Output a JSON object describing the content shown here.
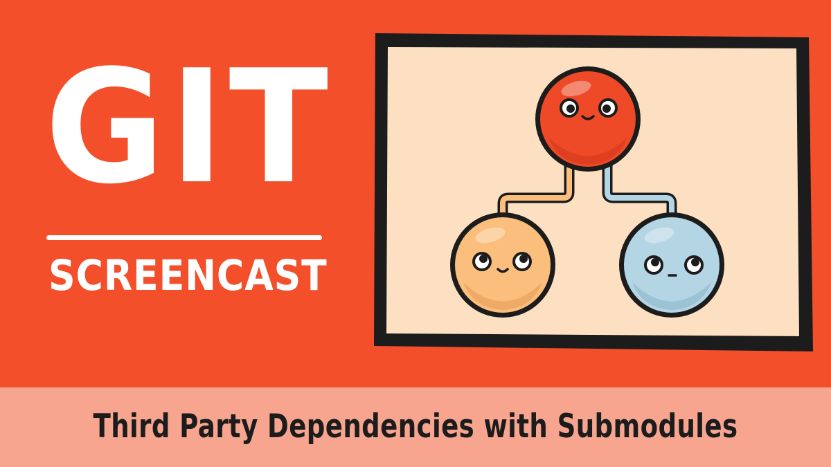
{
  "brand": {
    "title": "GIT",
    "subtitle": "SCREENCAST"
  },
  "episode": {
    "title": "Third Party Dependencies with Submodules"
  },
  "illustration": {
    "nodes": [
      {
        "role": "parent",
        "color": "#ee4a28"
      },
      {
        "role": "child-left",
        "color": "#fbbe7c"
      },
      {
        "role": "child-right",
        "color": "#b4d5e4"
      }
    ]
  },
  "colors": {
    "background": "#f34f2b",
    "band": "#f8a590",
    "frame_fill": "#fde0c2",
    "outline": "#1c1c1c",
    "text_light": "#ffffff"
  }
}
